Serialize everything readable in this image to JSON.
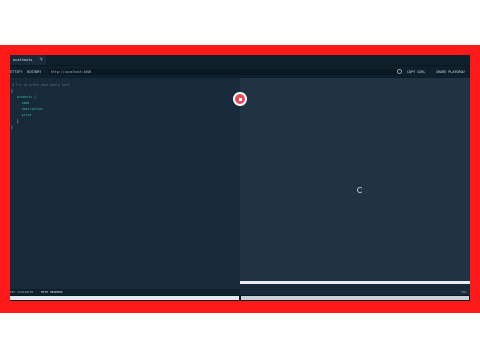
{
  "tab": {
    "label": "ocalhosts",
    "close": "×"
  },
  "tab_add": "+",
  "toolbar": {
    "prettify": "ETTIFY",
    "history": "HISTORY",
    "url": "http://localhost:4000",
    "copy_curl": "COPY CURL",
    "share": "SHARE PLAYGROU"
  },
  "editor": {
    "lines": [
      "# Try to write your query here",
      "{",
      "  products {",
      "    name",
      "    description",
      "    price",
      "  }",
      "}"
    ]
  },
  "bottom": {
    "query_variables": "ERY VARIABLES",
    "http_headers": "HTTP HEADERS",
    "right_label": "TRA"
  },
  "colors": {
    "frame": "#ff1a1a",
    "editor_bg": "#172a3a",
    "result_bg": "#1f3343",
    "run_button": "#e9495b",
    "field": "#39b8a1"
  }
}
